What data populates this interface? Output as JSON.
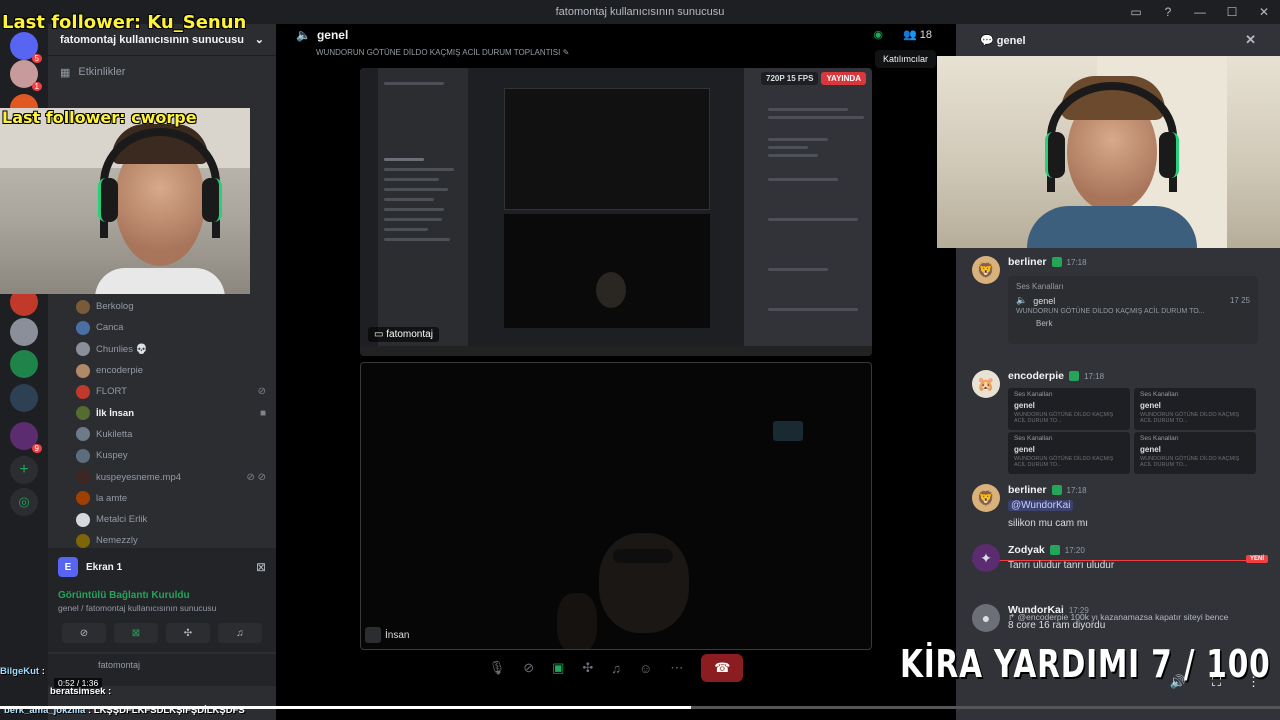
{
  "window": {
    "title": "fatomontaj kullanıcısının sunucusu",
    "controls": [
      "▭",
      "?",
      "—",
      "☐",
      "✕"
    ]
  },
  "overlay": {
    "last_follower_1": "Last follower: Ku_Senun",
    "last_follower_2": "Last follower: cworpe",
    "kira_text": "KİRA YARDIMI  7 / 100"
  },
  "sidebar": {
    "server_name": "fatomontaj kullanıcısının sunucusu",
    "events_label": "Etkinlikler",
    "members": [
      {
        "name": "Berkolog",
        "color": "#7a5a3a",
        "icon": ""
      },
      {
        "name": "Canca",
        "color": "#4a6fa5",
        "icon": ""
      },
      {
        "name": "Chunlies 💀",
        "color": "#8a8f99",
        "icon": ""
      },
      {
        "name": "encoderpie",
        "color": "#b08968",
        "icon": ""
      },
      {
        "name": "FLORT",
        "color": "#c0392b",
        "icon": "⊘"
      },
      {
        "name": "İlk İnsan",
        "color": "#556b2f",
        "icon": "■",
        "active": true
      },
      {
        "name": "Kukiletta",
        "color": "#6c7a89",
        "icon": ""
      },
      {
        "name": "Kuspey",
        "color": "#5d6d7e",
        "icon": ""
      },
      {
        "name": "kuspeyesneme.mp4",
        "color": "#3e2723",
        "icon": "⊘ ⊘"
      },
      {
        "name": "la amte",
        "color": "#a04000",
        "icon": ""
      },
      {
        "name": "Metalci Erlik",
        "color": "#d5d8dc",
        "icon": ""
      },
      {
        "name": "Nemezzly",
        "color": "#7d6608",
        "icon": ""
      }
    ]
  },
  "voice_panel": {
    "screen_name": "Ekran 1",
    "status": "Görüntülü Bağlantı Kuruldu",
    "location": "genel / fatomontaj kullanıcısının sunucusu",
    "user": "fatomontaj"
  },
  "main": {
    "channel": "genel",
    "topic": "WUNDORUN GÖTÜNE DİLDO KAÇMIŞ ACİL DURUM TOPLANTISI",
    "participant_count": "18",
    "tooltip": "Katılımcılar",
    "stream_badge_quality": "720P 15 FPS",
    "stream_badge_live": "YAYINDA",
    "stream_owner": "fatomontaj",
    "cam_user": "İnsan"
  },
  "chat": {
    "channel": "genel",
    "messages": [
      {
        "user": "berliner",
        "time": "17:18",
        "embed_title": "Ses Kanalları",
        "embed_channel": "genel",
        "embed_counts": "17  25",
        "embed_sub": "WUNDORUN GÖTÜNE DİLDO KAÇMIŞ ACİL DURUM TO...",
        "embed_user": "Berk"
      },
      {
        "user": "encoderpie",
        "time": "17:18",
        "mini_title": "Ses Kanalları",
        "mini_channel": "genel",
        "mini_sub": "WUNDORUN GÖTÜNE DİLDO KAÇMIŞ ACİL DURUM TO..."
      },
      {
        "user": "berliner",
        "time": "17:18",
        "mention": "@WundorKai",
        "text": "silikon mu cam mı"
      },
      {
        "user": "Zodyak",
        "time": "17:20",
        "text": "Tanrı uludur tanrı uludur"
      },
      {
        "user": "WundorKai",
        "time": "17:29",
        "reply_to": "@encoderpie 100k yı kazanamazsa kapatır siteyi bence",
        "text": "8 core 16 ram diyordu"
      }
    ],
    "new_label": "YENİ"
  },
  "ticker": {
    "line1_user": "BilgeKut",
    "line1_sep": ":",
    "line2_user": "beratsimsek",
    "line2_sep": ":",
    "line3_user": "berk_ama_jokzilla",
    "line3_text": ": LKŞŞDFLKFSDLKŞIFŞDİLKŞDFS"
  },
  "player": {
    "time": "0:52 / 1:36",
    "progress": 0.54
  }
}
